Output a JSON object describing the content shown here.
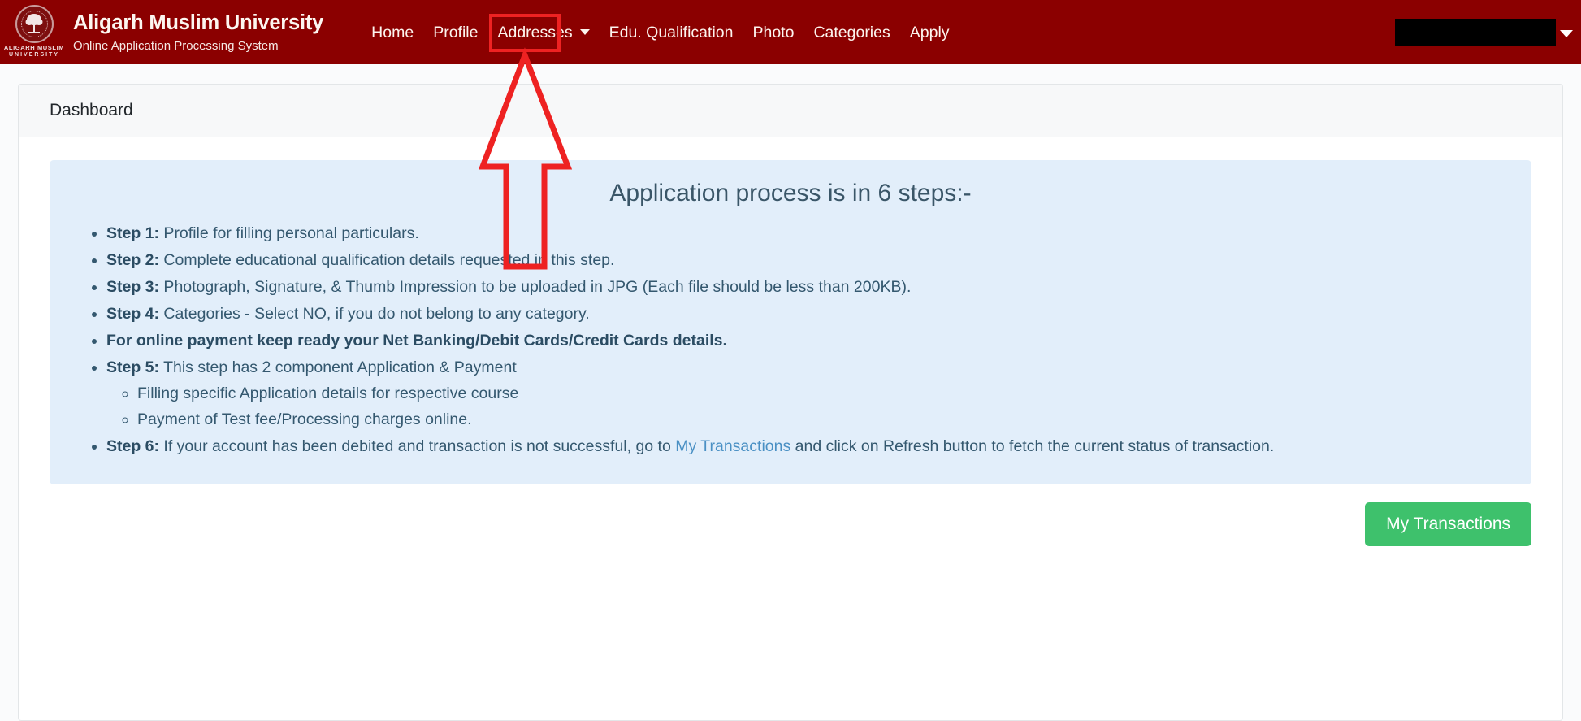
{
  "navbar": {
    "logo": {
      "icon": "university-crest-logo",
      "line1": "ALIGARH MUSLIM",
      "line2": "UNIVERSITY"
    },
    "brand_title": "Aligarh Muslim University",
    "brand_subtitle": "Online Application Processing System",
    "links": [
      {
        "label": "Home",
        "name": "nav-link-home",
        "has_caret": false
      },
      {
        "label": "Profile",
        "name": "nav-link-profile",
        "has_caret": false
      },
      {
        "label": "Addresses",
        "name": "nav-link-addresses",
        "has_caret": true
      },
      {
        "label": "Edu. Qualification",
        "name": "nav-link-edu-qualification",
        "has_caret": false
      },
      {
        "label": "Photo",
        "name": "nav-link-photo",
        "has_caret": false
      },
      {
        "label": "Categories",
        "name": "nav-link-categories",
        "has_caret": false
      },
      {
        "label": "Apply",
        "name": "nav-link-apply",
        "has_caret": false
      }
    ],
    "user_menu": {
      "label": "",
      "redacted": true,
      "caret_icon": "chevron-down-icon"
    },
    "background_color": "#8b0000"
  },
  "card": {
    "header_title": "Dashboard"
  },
  "alert": {
    "heading": "Application process is in 6 steps:-",
    "background_color": "#e2eefa",
    "steps": [
      {
        "label": "Step 1:",
        "text": " Profile for filling personal particulars.",
        "bold_whole": false,
        "substeps": []
      },
      {
        "label": "Step 2:",
        "text": " Complete educational qualification details requested in this step.",
        "bold_whole": false,
        "substeps": []
      },
      {
        "label": "Step 3:",
        "text": " Photograph, Signature, & Thumb Impression to be uploaded in JPG (Each file should be less than 200KB).",
        "bold_whole": false,
        "substeps": []
      },
      {
        "label": "Step 4:",
        "text": " Categories - Select NO, if you do not belong to any category.",
        "bold_whole": false,
        "substeps": []
      },
      {
        "label": "",
        "text": "For online payment keep ready your Net Banking/Debit Cards/Credit Cards details.",
        "bold_whole": true,
        "substeps": []
      },
      {
        "label": "Step 5:",
        "text": " This step has 2 component Application & Payment",
        "bold_whole": false,
        "substeps": [
          "Filling specific Application details for respective course",
          "Payment of Test fee/Processing charges online."
        ]
      }
    ],
    "step6": {
      "label": "Step 6:",
      "text_before_link": " If your account has been debited and transaction is not successful, go to ",
      "link_label": "My Transactions",
      "link_color": "#4a90c4",
      "text_after_link": " and click on Refresh button to fetch the current status of transaction."
    }
  },
  "footer": {
    "my_transactions_button": "My Transactions",
    "button_color": "#3ec16c"
  },
  "annotation": {
    "type": "red-arrow-pointing-up",
    "target": "Profile",
    "color": "#ee2222",
    "highlight_box_target": "Profile"
  }
}
